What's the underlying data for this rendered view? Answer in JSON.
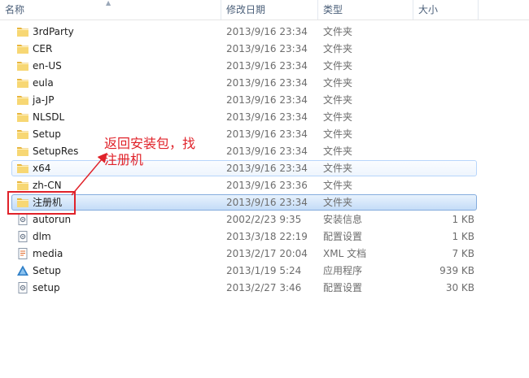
{
  "columns": {
    "name": "名称",
    "date": "修改日期",
    "type": "类型",
    "size": "大小"
  },
  "files": [
    {
      "name": "3rdParty",
      "date": "2013/9/16 23:34",
      "type": "文件夹",
      "size": "",
      "icon": "folder-icon"
    },
    {
      "name": "CER",
      "date": "2013/9/16 23:34",
      "type": "文件夹",
      "size": "",
      "icon": "folder-icon"
    },
    {
      "name": "en-US",
      "date": "2013/9/16 23:34",
      "type": "文件夹",
      "size": "",
      "icon": "folder-icon"
    },
    {
      "name": "eula",
      "date": "2013/9/16 23:34",
      "type": "文件夹",
      "size": "",
      "icon": "folder-icon"
    },
    {
      "name": "ja-JP",
      "date": "2013/9/16 23:34",
      "type": "文件夹",
      "size": "",
      "icon": "folder-icon"
    },
    {
      "name": "NLSDL",
      "date": "2013/9/16 23:34",
      "type": "文件夹",
      "size": "",
      "icon": "folder-icon"
    },
    {
      "name": "Setup",
      "date": "2013/9/16 23:34",
      "type": "文件夹",
      "size": "",
      "icon": "folder-icon"
    },
    {
      "name": "SetupRes",
      "date": "2013/9/16 23:34",
      "type": "文件夹",
      "size": "",
      "icon": "folder-icon"
    },
    {
      "name": "x64",
      "date": "2013/9/16 23:34",
      "type": "文件夹",
      "size": "",
      "icon": "folder-icon",
      "state": "hover"
    },
    {
      "name": "zh-CN",
      "date": "2013/9/16 23:36",
      "type": "文件夹",
      "size": "",
      "icon": "folder-icon"
    },
    {
      "name": "注册机",
      "date": "2013/9/16 23:34",
      "type": "文件夹",
      "size": "",
      "icon": "folder-icon",
      "state": "selected"
    },
    {
      "name": "autorun",
      "date": "2002/2/23 9:35",
      "type": "安装信息",
      "size": "1 KB",
      "icon": "settings-file-icon"
    },
    {
      "name": "dlm",
      "date": "2013/3/18 22:19",
      "type": "配置设置",
      "size": "1 KB",
      "icon": "settings-file-icon"
    },
    {
      "name": "media",
      "date": "2013/2/17 20:04",
      "type": "XML 文档",
      "size": "7 KB",
      "icon": "xml-file-icon"
    },
    {
      "name": "Setup",
      "date": "2013/1/19 5:24",
      "type": "应用程序",
      "size": "939 KB",
      "icon": "app-icon"
    },
    {
      "name": "setup",
      "date": "2013/2/27 3:46",
      "type": "配置设置",
      "size": "30 KB",
      "icon": "settings-file-icon"
    }
  ],
  "annotation": {
    "line1": "返回安装包，找",
    "line2": "注册机"
  },
  "colors": {
    "annotation": "#e0222a",
    "selected_border": "#84acdd",
    "hover_border": "#b8d6fb",
    "folder": "#f2c94c"
  }
}
